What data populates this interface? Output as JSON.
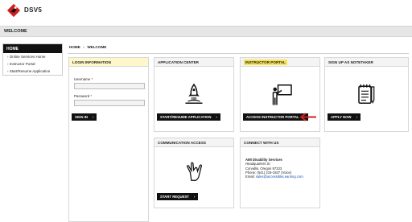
{
  "header": {
    "brand": "DSV5"
  },
  "title_bar": {
    "title": "WELCOME"
  },
  "sidebar": {
    "heading": "HOME",
    "items": [
      {
        "label": "Online Services Home"
      },
      {
        "label": "Instructor Portal"
      },
      {
        "label": "Start/Resume Application"
      }
    ]
  },
  "breadcrumb": {
    "home": "HOME",
    "separator": "»",
    "current": "WELCOME"
  },
  "login": {
    "title": "LOGIN INFORMATION",
    "username_label": "Username",
    "password_label": "Password",
    "required_mark": "*",
    "username_value": "",
    "password_value": "",
    "sign_in": "SIGN IN",
    "chevron": "›"
  },
  "cards": {
    "application": {
      "title": "APPLICATION CENTER",
      "button": "START/RESUME APPLICATION",
      "icon": "rocket-icon"
    },
    "instructor": {
      "title": "INSTRUCTOR PORTAL",
      "button": "ACCESS INSTRUCTOR PORTAL",
      "icon": "teacher-board-icon"
    },
    "notetaker": {
      "title": "SIGN UP AS NOTETAKER",
      "button": "APPLY NOW",
      "icon": "notepad-pen-icon"
    },
    "communication": {
      "title": "COMMUNICATION ACCESS",
      "button": "START REQUEST",
      "icon": "sign-language-hand-icon"
    },
    "contact": {
      "title": "CONNECT WITH US",
      "org": "AIM Disability Services",
      "line1": "Headquarters St",
      "line2": "Corvallis, Oregon 97333",
      "line3": "Phone: (541) 219-1937 (Voice)",
      "email_label": "Email:",
      "email": "sales@accessibleLearning.com"
    }
  },
  "colors": {
    "accent_red": "#cc1f1f",
    "highlight_yellow": "#f5e35a",
    "header_yellow": "#fdf7c9",
    "button_black": "#111111"
  }
}
